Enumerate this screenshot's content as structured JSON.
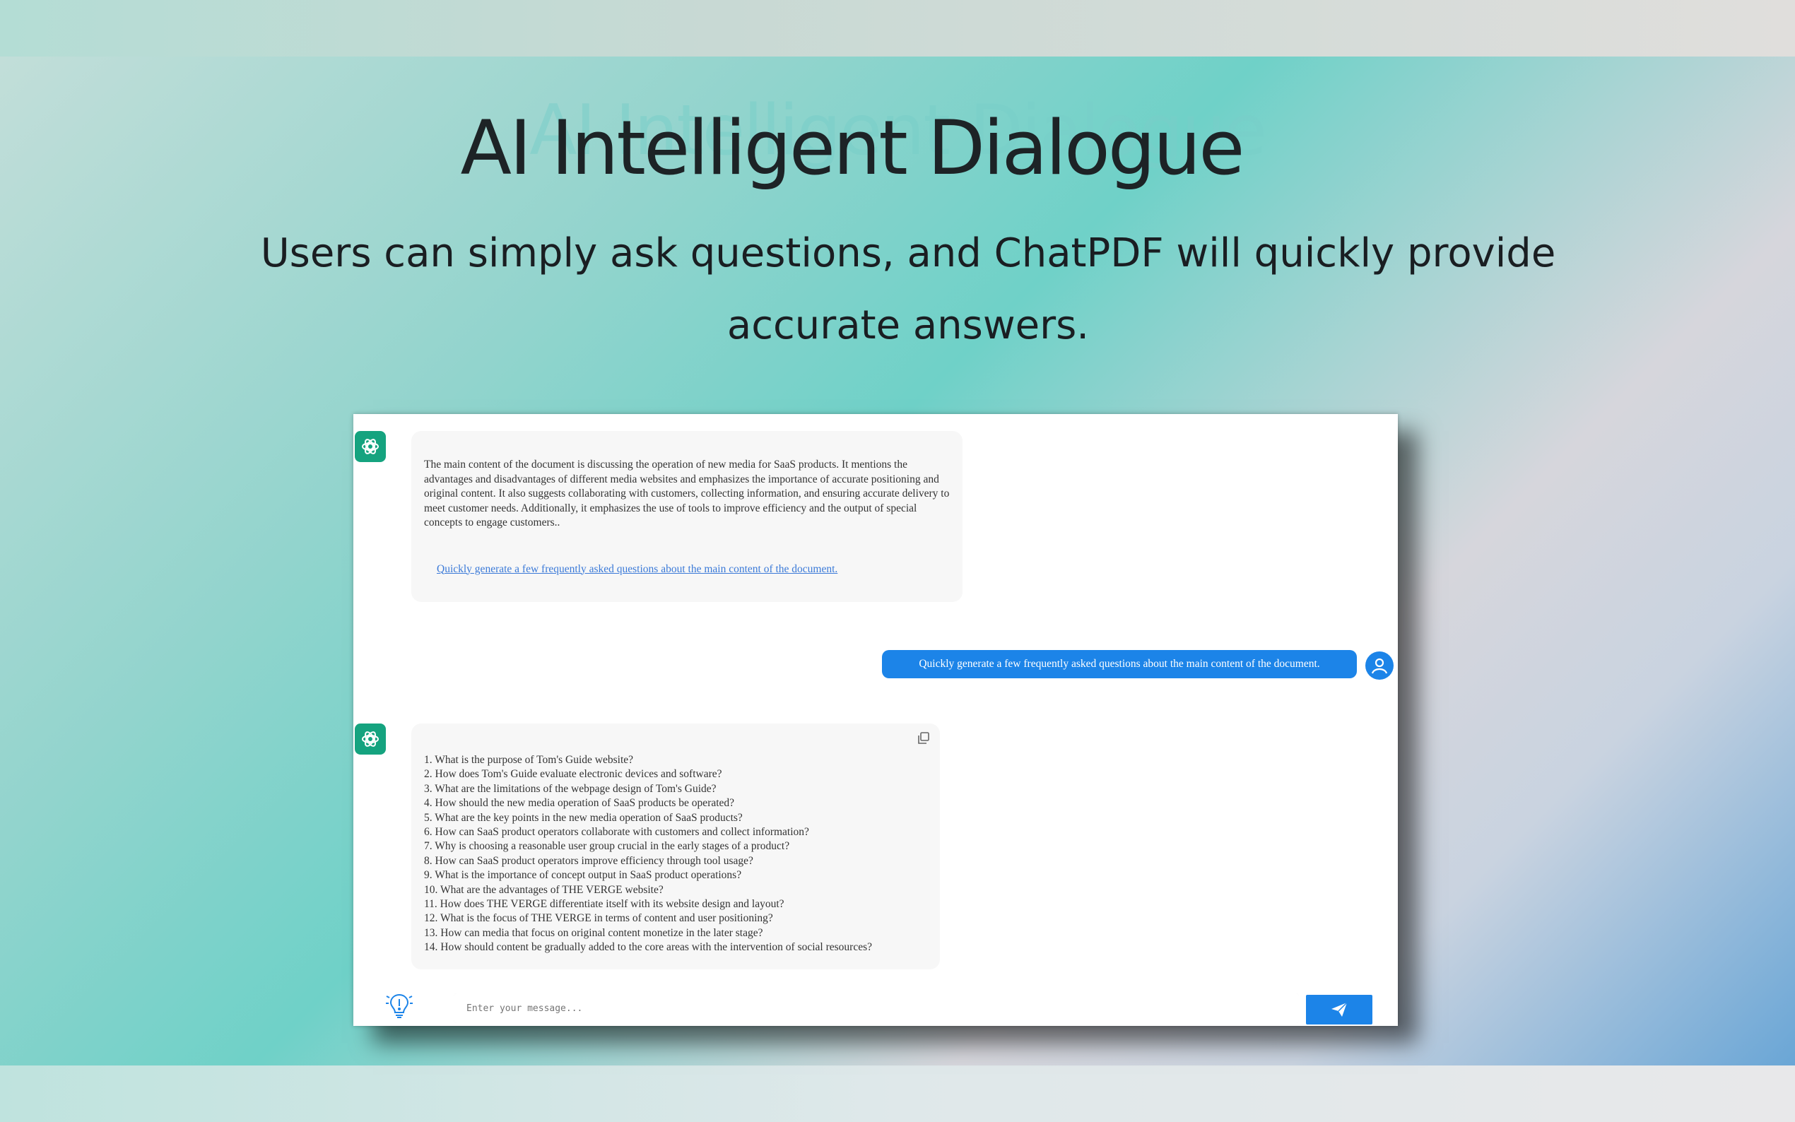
{
  "hero": {
    "title": "AI Intelligent Dialogue",
    "subtitle": "Users can simply ask questions, and ChatPDF will quickly provide accurate answers."
  },
  "chat": {
    "summary_text": "The main content of the document is discussing the operation of new media for SaaS products. It mentions the advantages and disadvantages of different media websites and emphasizes the importance of accurate positioning and original content. It also suggests collaborating with customers, collecting information, and ensuring accurate delivery to meet customer needs. Additionally, it emphasizes the use of tools to improve efficiency and the output of special concepts to engage customers..",
    "suggestion_link": "Quickly generate a few frequently asked questions about the main content of the document.",
    "user_message": "Quickly generate a few frequently asked questions about the main content of the document.",
    "answer_items": [
      "1. What is the purpose of Tom's Guide website?",
      "2. How does Tom's Guide evaluate electronic devices and software?",
      "3. What are the limitations of the webpage design of Tom's Guide?",
      "4. How should the new media operation of SaaS products be operated?",
      "5. What are the key points in the new media operation of SaaS products?",
      "6. How can SaaS product operators collaborate with customers and collect information?",
      "7. Why is choosing a reasonable user group crucial in the early stages of a product?",
      "8. How can SaaS product operators improve efficiency through tool usage?",
      "9. What is the importance of concept output in SaaS product operations?",
      "10. What are the advantages of THE VERGE website?",
      "11. How does THE VERGE differentiate itself with its website design and layout?",
      "12. What is the focus of THE VERGE in terms of content and user positioning?",
      "13. How can media that focus on original content monetize in the later stage?",
      "14. How should content be gradually added to the core areas with the intervention of social resources?"
    ]
  },
  "composer": {
    "placeholder": "Enter your message..."
  },
  "icons": {
    "bot": "openai-logo-icon",
    "user": "user-icon",
    "copy": "copy-icon",
    "tips": "lightbulb-icon",
    "send": "paper-plane-icon"
  },
  "colors": {
    "accent": "#1c84e8",
    "bot": "#15a37f"
  }
}
